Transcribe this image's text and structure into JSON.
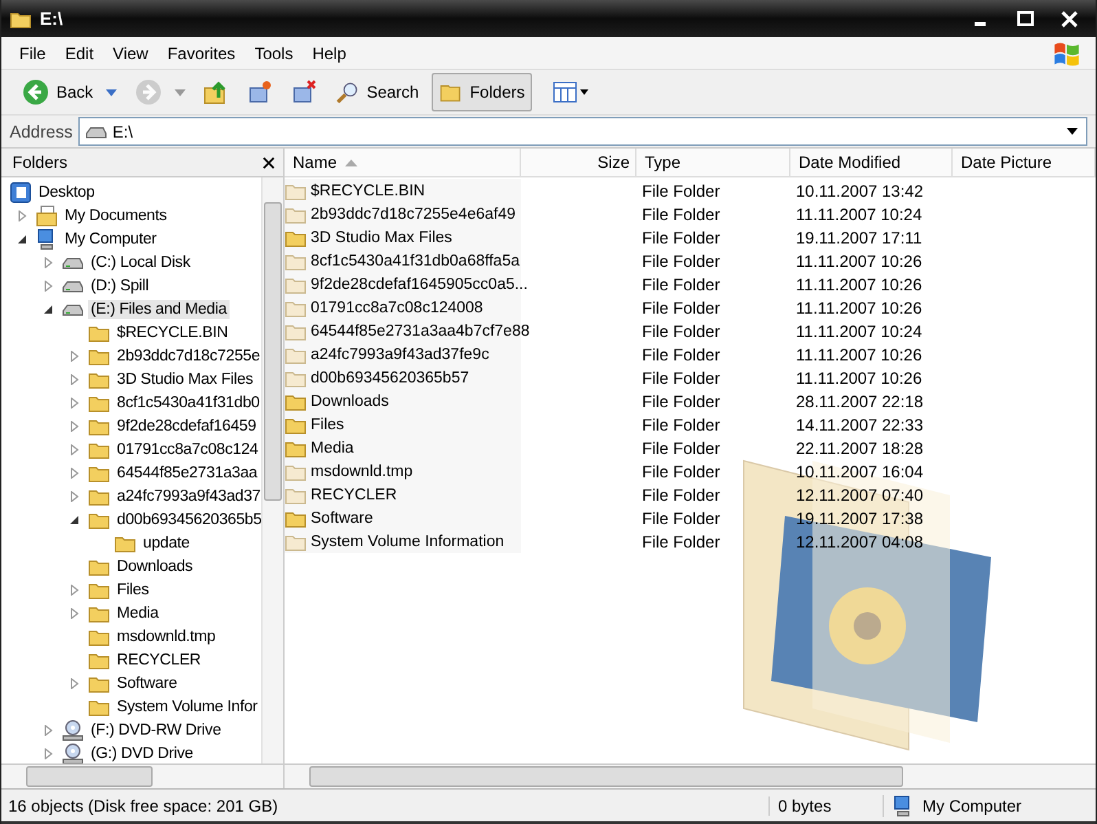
{
  "window": {
    "title": "E:\\"
  },
  "menu": [
    "File",
    "Edit",
    "View",
    "Favorites",
    "Tools",
    "Help"
  ],
  "toolbar": {
    "back": {
      "label": "Back",
      "disabled": false
    },
    "forward": {
      "disabled": true
    },
    "search": {
      "label": "Search"
    },
    "folders": {
      "label": "Folders",
      "selected": true
    }
  },
  "address": {
    "label": "Address",
    "value": "E:\\"
  },
  "folders_pane": {
    "title": "Folders",
    "tree": {
      "label": "Desktop",
      "kind": "desktop",
      "selected": false,
      "children": [
        {
          "label": "My Documents",
          "kind": "documents",
          "selected": false,
          "expanded": false
        },
        {
          "label": "My Computer",
          "kind": "computer",
          "selected": false,
          "expanded": true,
          "children": [
            {
              "label": "(C:) Local Disk",
              "kind": "drive",
              "selected": false,
              "expanded": false
            },
            {
              "label": "(D:) Spill",
              "kind": "drive",
              "selected": false,
              "expanded": false
            },
            {
              "label": "(E:) Files and Media",
              "kind": "drive",
              "selected": true,
              "expanded": true,
              "children": [
                {
                  "label": "$RECYCLE.BIN",
                  "kind": "folder",
                  "selected": false
                },
                {
                  "label": "2b93ddc7d18c7255e",
                  "kind": "folder",
                  "selected": false,
                  "expanded": false
                },
                {
                  "label": "3D Studio Max Files",
                  "kind": "folder",
                  "selected": false,
                  "expanded": false
                },
                {
                  "label": "8cf1c5430a41f31db0",
                  "kind": "folder",
                  "selected": false,
                  "expanded": false
                },
                {
                  "label": "9f2de28cdefaf16459",
                  "kind": "folder",
                  "selected": false,
                  "expanded": false
                },
                {
                  "label": "01791cc8a7c08c124",
                  "kind": "folder",
                  "selected": false,
                  "expanded": false
                },
                {
                  "label": "64544f85e2731a3aa",
                  "kind": "folder",
                  "selected": false,
                  "expanded": false
                },
                {
                  "label": "a24fc7993a9f43ad37",
                  "kind": "folder",
                  "selected": false,
                  "expanded": false
                },
                {
                  "label": "d00b69345620365b5",
                  "kind": "folder",
                  "selected": false,
                  "expanded": true,
                  "children": [
                    {
                      "label": "update",
                      "kind": "folder",
                      "selected": false
                    }
                  ]
                },
                {
                  "label": "Downloads",
                  "kind": "folder",
                  "selected": false
                },
                {
                  "label": "Files",
                  "kind": "folder",
                  "selected": false,
                  "expanded": false
                },
                {
                  "label": "Media",
                  "kind": "folder",
                  "selected": false,
                  "expanded": false
                },
                {
                  "label": "msdownld.tmp",
                  "kind": "folder",
                  "selected": false
                },
                {
                  "label": "RECYCLER",
                  "kind": "folder",
                  "selected": false
                },
                {
                  "label": "Software",
                  "kind": "folder",
                  "selected": false,
                  "expanded": false
                },
                {
                  "label": "System Volume Infor",
                  "kind": "folder",
                  "selected": false
                }
              ]
            },
            {
              "label": "(F:) DVD-RW Drive",
              "kind": "dvd",
              "selected": false,
              "expanded": false
            },
            {
              "label": "(G:) DVD Drive",
              "kind": "dvd",
              "selected": false,
              "expanded": false
            }
          ]
        }
      ]
    }
  },
  "file_list": {
    "columns": [
      {
        "label": "Name",
        "sorted": true
      },
      {
        "label": "Size",
        "sorted": false
      },
      {
        "label": "Type",
        "sorted": false
      },
      {
        "label": "Date Modified",
        "sorted": false
      },
      {
        "label": "Date Picture",
        "sorted": false
      }
    ],
    "rows": [
      {
        "name": "$RECYCLE.BIN",
        "hidden": true,
        "type": "File Folder",
        "date_modified": "10.11.2007 13:42"
      },
      {
        "name": "2b93ddc7d18c7255e4e6af49",
        "hidden": true,
        "type": "File Folder",
        "date_modified": "11.11.2007 10:24"
      },
      {
        "name": "3D Studio Max Files",
        "hidden": false,
        "type": "File Folder",
        "date_modified": "19.11.2007 17:11"
      },
      {
        "name": "8cf1c5430a41f31db0a68ffa5a",
        "hidden": true,
        "type": "File Folder",
        "date_modified": "11.11.2007 10:26"
      },
      {
        "name": "9f2de28cdefaf1645905cc0a5...",
        "hidden": true,
        "type": "File Folder",
        "date_modified": "11.11.2007 10:26"
      },
      {
        "name": "01791cc8a7c08c124008",
        "hidden": true,
        "type": "File Folder",
        "date_modified": "11.11.2007 10:26"
      },
      {
        "name": "64544f85e2731a3aa4b7cf7e88",
        "hidden": true,
        "type": "File Folder",
        "date_modified": "11.11.2007 10:24"
      },
      {
        "name": "a24fc7993a9f43ad37fe9c",
        "hidden": true,
        "type": "File Folder",
        "date_modified": "11.11.2007 10:26"
      },
      {
        "name": "d00b69345620365b57",
        "hidden": true,
        "type": "File Folder",
        "date_modified": "11.11.2007 10:26"
      },
      {
        "name": "Downloads",
        "hidden": false,
        "type": "File Folder",
        "date_modified": "28.11.2007 22:18"
      },
      {
        "name": "Files",
        "hidden": false,
        "type": "File Folder",
        "date_modified": "14.11.2007 22:33"
      },
      {
        "name": "Media",
        "hidden": false,
        "type": "File Folder",
        "date_modified": "22.11.2007 18:28"
      },
      {
        "name": "msdownld.tmp",
        "hidden": true,
        "type": "File Folder",
        "date_modified": "10.11.2007 16:04"
      },
      {
        "name": "RECYCLER",
        "hidden": true,
        "type": "File Folder",
        "date_modified": "12.11.2007 07:40"
      },
      {
        "name": "Software",
        "hidden": false,
        "type": "File Folder",
        "date_modified": "19.11.2007 17:38"
      },
      {
        "name": "System Volume Information",
        "hidden": true,
        "type": "File Folder",
        "date_modified": "12.11.2007 04:08"
      }
    ]
  },
  "status_bar": {
    "summary": "16 objects (Disk free space: 201 GB)",
    "size": "0 bytes",
    "location": "My Computer"
  }
}
